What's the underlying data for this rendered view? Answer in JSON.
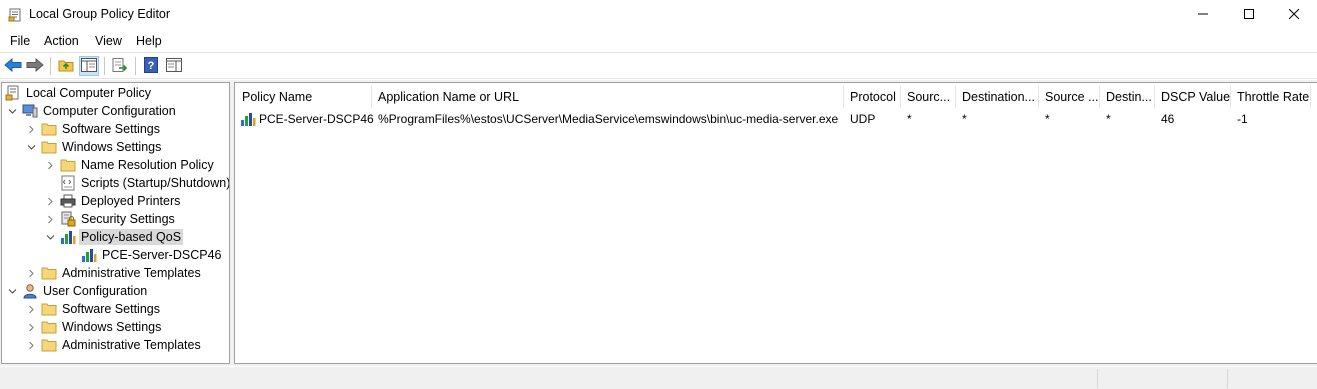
{
  "window": {
    "title": "Local Group Policy Editor",
    "icons": {
      "app": "policy-document-icon",
      "minimize": "minimize-icon",
      "maximize": "maximize-icon",
      "close": "close-icon"
    }
  },
  "menu": {
    "items": [
      "File",
      "Action",
      "View",
      "Help"
    ]
  },
  "toolbar": {
    "buttons": [
      "back-arrow-icon",
      "forward-arrow-icon",
      "up-folder-icon",
      "show-hide-tree-icon",
      "export-list-icon",
      "help-icon",
      "properties-pane-icon"
    ]
  },
  "tree": {
    "root": "Local Computer Policy",
    "computer_configuration": "Computer Configuration",
    "cc_software_settings": "Software Settings",
    "cc_windows_settings": "Windows Settings",
    "name_resolution_policy": "Name Resolution Policy",
    "scripts": "Scripts (Startup/Shutdown)",
    "deployed_printers": "Deployed Printers",
    "security_settings": "Security Settings",
    "policy_based_qos": "Policy-based QoS",
    "qos_child": "PCE-Server-DSCP46",
    "cc_admin_templates": "Administrative Templates",
    "user_configuration": "User Configuration",
    "uc_software_settings": "Software Settings",
    "uc_windows_settings": "Windows Settings",
    "uc_admin_templates": "Administrative Templates"
  },
  "list": {
    "columns": [
      "Policy Name",
      "Application Name or URL",
      "Protocol",
      "Sourc...",
      "Destination...",
      "Source ...",
      "Destin...",
      "DSCP Value",
      "Throttle Rate"
    ],
    "rows": [
      [
        "PCE-Server-DSCP46",
        "%ProgramFiles%\\estos\\UCServer\\MediaService\\emswindows\\bin\\uc-media-server.exe",
        "UDP",
        "*",
        "*",
        "*",
        "*",
        "46",
        "-1"
      ]
    ]
  },
  "colors": {
    "selection": "#d9d9d9",
    "toolbar_active": "#cce4f7",
    "pane_border": "#a0a0a0",
    "background": "#f0f0f0"
  }
}
